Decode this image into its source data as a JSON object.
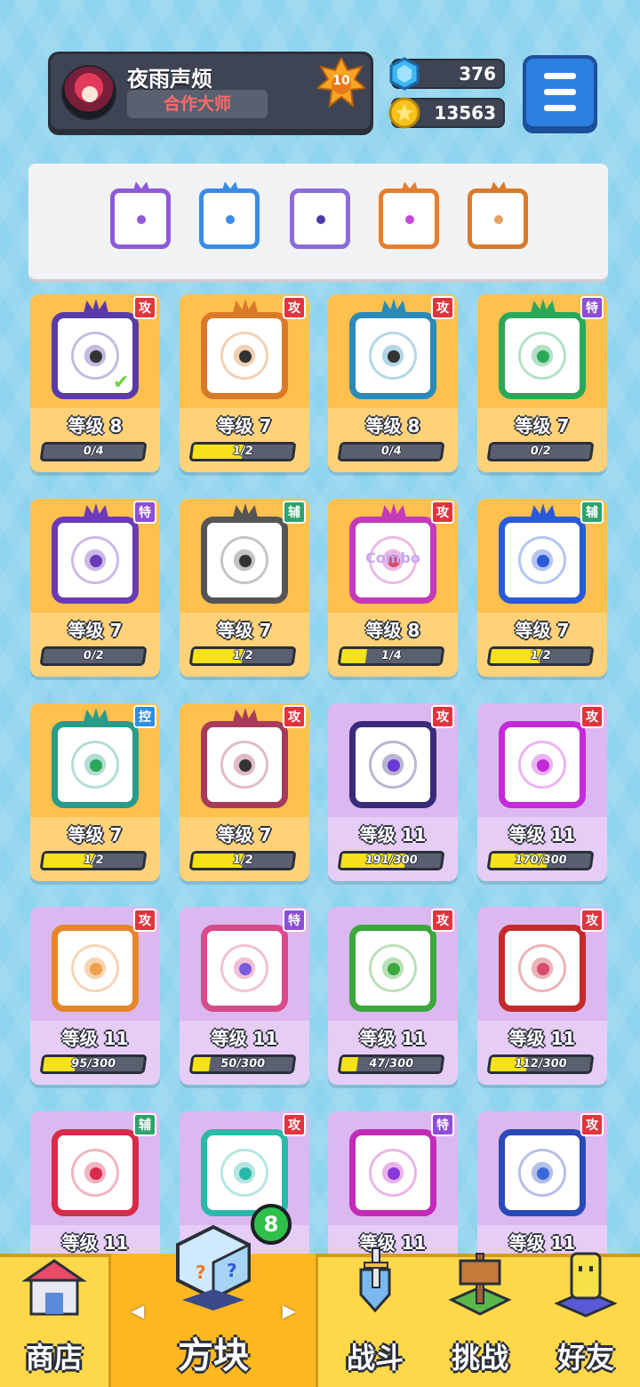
{
  "player": {
    "name": "夜雨声烦",
    "title": "合作大师",
    "rank": "10"
  },
  "resources": {
    "gems": "376",
    "coins": "13563",
    "gem_icon": "blue-gem-icon",
    "coin_icon": "gold-coin-icon"
  },
  "menu": {
    "icon": "hamburger-menu-icon"
  },
  "equipped": [
    {
      "name": "purple-vortex",
      "color": "#8e5ad9"
    },
    {
      "name": "ice-snowflake",
      "color": "#3a8be6"
    },
    {
      "name": "crack-lightning",
      "color": "#8c6cd9"
    },
    {
      "name": "infinity",
      "color": "#e67e2e"
    },
    {
      "name": "sand",
      "color": "#d97a2a"
    }
  ],
  "cards": [
    {
      "tag": "攻",
      "tag_type": "atk",
      "level": "等级 8",
      "progress": "0/4",
      "pct": 0,
      "frame": "#5a3aa8",
      "dot": "#333",
      "tier": "gold",
      "check": true
    },
    {
      "tag": "攻",
      "tag_type": "atk",
      "level": "等级 7",
      "progress": "1/2",
      "pct": 50,
      "frame": "#d9792a",
      "dot": "#333",
      "tier": "gold"
    },
    {
      "tag": "攻",
      "tag_type": "atk",
      "level": "等级 8",
      "progress": "0/4",
      "pct": 0,
      "frame": "#2a8ab8",
      "dot": "#333",
      "tier": "gold"
    },
    {
      "tag": "特",
      "tag_type": "spc",
      "level": "等级 7",
      "progress": "0/2",
      "pct": 0,
      "frame": "#2aa85a",
      "dot": "#2aa85a",
      "tier": "gold"
    },
    {
      "tag": "特",
      "tag_type": "spc",
      "level": "等级 7",
      "progress": "0/2",
      "pct": 0,
      "frame": "#6a3ab8",
      "dot": "#6a3ab8",
      "tier": "gold"
    },
    {
      "tag": "辅",
      "tag_type": "sup",
      "level": "等级 7",
      "progress": "1/2",
      "pct": 50,
      "frame": "#555",
      "dot": "#333",
      "tier": "gold"
    },
    {
      "tag": "攻",
      "tag_type": "atk",
      "level": "等级 8",
      "progress": "1/4",
      "pct": 25,
      "frame": "#c43ab8",
      "dot": "#d94a6a",
      "tier": "gold",
      "text": "Combo"
    },
    {
      "tag": "辅",
      "tag_type": "sup",
      "level": "等级 7",
      "progress": "1/2",
      "pct": 50,
      "frame": "#2a5ad9",
      "dot": "#2a5ad9",
      "tier": "gold"
    },
    {
      "tag": "控",
      "tag_type": "ctl",
      "level": "等级 7",
      "progress": "1/2",
      "pct": 50,
      "frame": "#2a9a8a",
      "dot": "#2aa85a",
      "tier": "gold"
    },
    {
      "tag": "攻",
      "tag_type": "atk",
      "level": "等级 7",
      "progress": "1/2",
      "pct": 50,
      "frame": "#a83a5a",
      "dot": "#333",
      "tier": "gold"
    },
    {
      "tag": "攻",
      "tag_type": "atk",
      "level": "等级 11",
      "progress": "191/300",
      "pct": 64,
      "frame": "#3a2a7a",
      "dot": "#6a3ad9",
      "tier": "purple"
    },
    {
      "tag": "攻",
      "tag_type": "atk",
      "level": "等级 11",
      "progress": "170/300",
      "pct": 57,
      "frame": "#c42ad9",
      "dot": "#c42ad9",
      "tier": "purple"
    },
    {
      "tag": "攻",
      "tag_type": "atk",
      "level": "等级 11",
      "progress": "95/300",
      "pct": 32,
      "frame": "#e6862a",
      "dot": "#f0a04a",
      "tier": "purple"
    },
    {
      "tag": "特",
      "tag_type": "spc",
      "level": "等级 11",
      "progress": "50/300",
      "pct": 17,
      "frame": "#d94a8a",
      "dot": "#7a5ad9",
      "tier": "purple"
    },
    {
      "tag": "攻",
      "tag_type": "atk",
      "level": "等级 11",
      "progress": "47/300",
      "pct": 16,
      "frame": "#3aa83a",
      "dot": "#3aa83a",
      "tier": "purple"
    },
    {
      "tag": "攻",
      "tag_type": "atk",
      "level": "等级 11",
      "progress": "112/300",
      "pct": 37,
      "frame": "#c42a2a",
      "dot": "#d94a6a",
      "tier": "purple"
    },
    {
      "tag": "辅",
      "tag_type": "sup",
      "level": "等级 11",
      "progress": "",
      "pct": 0,
      "frame": "#d92a4a",
      "dot": "#d92a4a",
      "tier": "purple"
    },
    {
      "tag": "攻",
      "tag_type": "atk",
      "level": "",
      "progress": "",
      "pct": 0,
      "frame": "#2ab8a8",
      "dot": "#2ab8a8",
      "tier": "purple"
    },
    {
      "tag": "特",
      "tag_type": "spc",
      "level": "等级 11",
      "progress": "",
      "pct": 0,
      "frame": "#c42ab8",
      "dot": "#8a3ad9",
      "tier": "purple"
    },
    {
      "tag": "攻",
      "tag_type": "atk",
      "level": "等级 11",
      "progress": "",
      "pct": 0,
      "frame": "#2a4ab8",
      "dot": "#3a6ad9",
      "tier": "purple"
    }
  ],
  "nav": {
    "shop": "商店",
    "blocks": "方块",
    "battle": "战斗",
    "challenge": "挑战",
    "friends": "好友",
    "blocks_badge": "8",
    "left_arrow": "◀",
    "right_arrow": "▶"
  }
}
